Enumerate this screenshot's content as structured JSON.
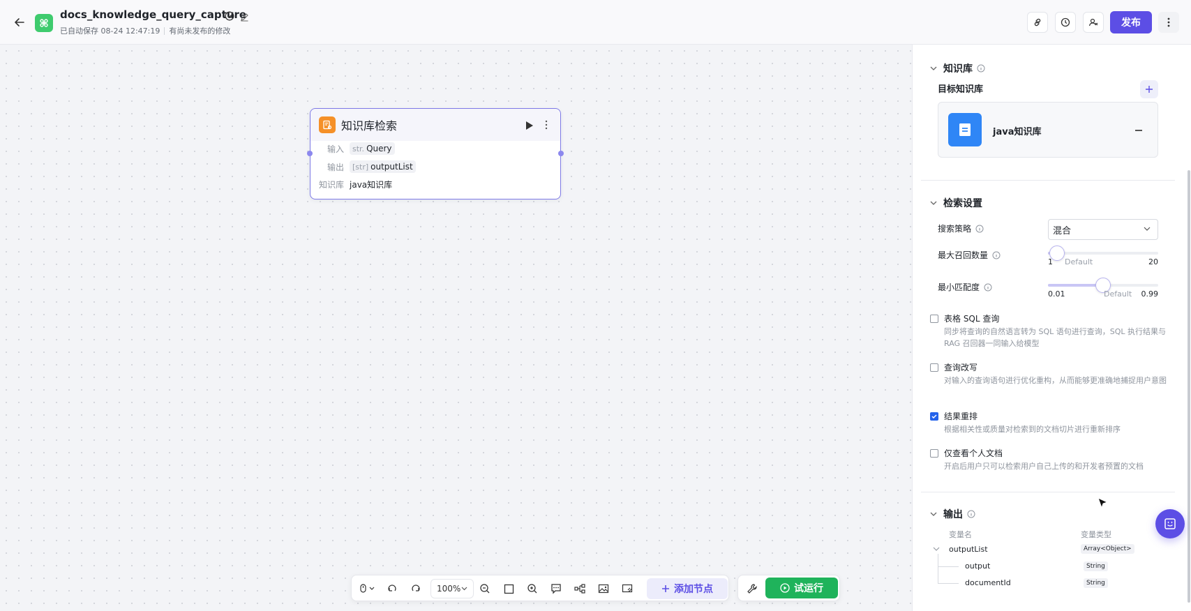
{
  "header": {
    "title": "docs_knowledge_query_capture",
    "autosave": "已自动保存 08-24 12:47:19",
    "unpublished": "有尚未发布的修改",
    "publish_label": "发布"
  },
  "node": {
    "title": "知识库检索",
    "input_label": "输入",
    "input_type": "str.",
    "input_value": "Query",
    "output_label": "输出",
    "output_type": "[str]",
    "output_value": "outputList",
    "kb_label": "知识库",
    "kb_value": "java知识库"
  },
  "toolbar": {
    "zoom": "100%",
    "add_node_label": "添加节点",
    "run_label": "试运行"
  },
  "panel": {
    "kb_section": {
      "title": "知识库",
      "target_label": "目标知识库",
      "kb_name": "java知识库"
    },
    "search_section": {
      "title": "检索设置",
      "strategy_label": "搜索策略",
      "strategy_value": "混合",
      "max_recall_label": "最大召回数量",
      "max_recall": {
        "min": "1",
        "default_label": "Default",
        "max": "20",
        "value_fraction": 0.08
      },
      "min_match_label": "最小匹配度",
      "min_match": {
        "min": "0.01",
        "default_label": "Default",
        "max": "0.99",
        "value_fraction": 0.5
      }
    },
    "options": [
      {
        "title": "表格 SQL 查询",
        "desc": "同步将查询的自然语言转为 SQL 语句进行查询，SQL 执行结果与 RAG 召回器一同输入给模型",
        "checked": false
      },
      {
        "title": "查询改写",
        "desc": "对输入的查询语句进行优化重构，从而能够更准确地捕捉用户意图",
        "checked": false
      },
      {
        "title": "结果重排",
        "desc": "根据相关性或质量对检索到的文档切片进行重新排序",
        "checked": true
      },
      {
        "title": "仅查看个人文档",
        "desc": "开启后用户只可以检索用户自己上传的和开发者预置的文档",
        "checked": false
      }
    ],
    "output_section": {
      "title": "输出",
      "col_name": "变量名",
      "col_type": "变量类型",
      "root_name": "outputList",
      "root_type": "Array<Object>",
      "children": [
        {
          "name": "output",
          "type": "String"
        },
        {
          "name": "documentId",
          "type": "String"
        }
      ]
    }
  },
  "colors": {
    "accent": "#5c4ee5",
    "run": "#1fb35b",
    "kb_icon": "#2f86f6",
    "node_icon": "#f59028"
  }
}
